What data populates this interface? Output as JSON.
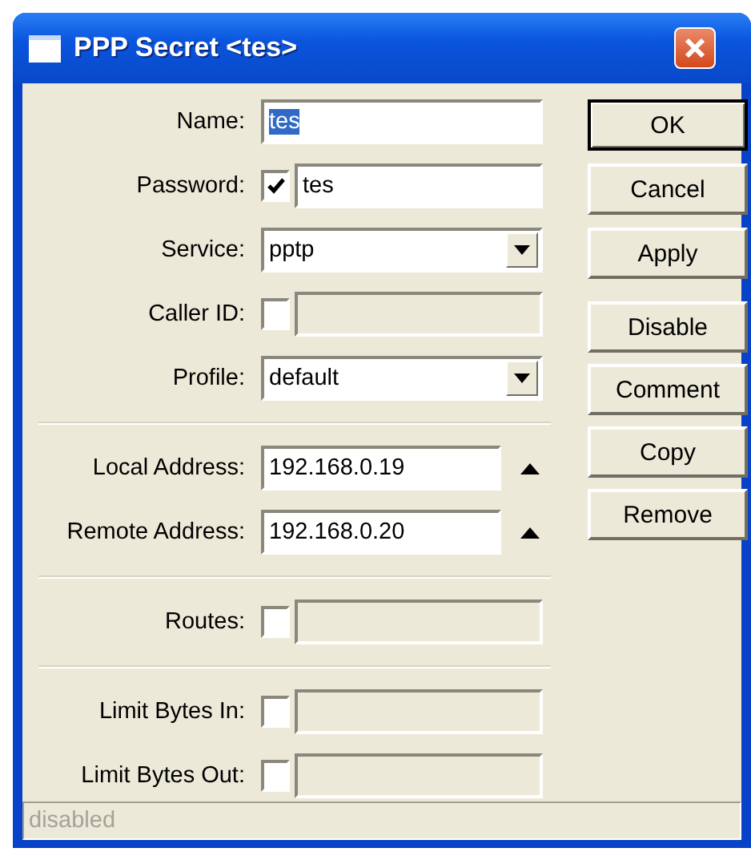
{
  "window": {
    "title": "PPP Secret <tes>"
  },
  "groups": [
    {
      "fields": [
        {
          "kind": "text",
          "label": "Name:",
          "value": "tes",
          "highlighted": true
        },
        {
          "kind": "checktext",
          "label": "Password:",
          "checked": true,
          "value": "tes",
          "highlighted": false
        },
        {
          "kind": "combo",
          "label": "Service:",
          "value": "pptp"
        },
        {
          "kind": "checktext",
          "label": "Caller ID:",
          "checked": false
        },
        {
          "kind": "combo",
          "label": "Profile:",
          "value": "default"
        }
      ]
    },
    {
      "fields": [
        {
          "kind": "ip",
          "label": "Local Address:",
          "value": "192.168.0.19",
          "highlighted": false
        },
        {
          "kind": "ip",
          "label": "Remote Address:",
          "value": "192.168.0.20",
          "highlighted": false
        }
      ]
    },
    {
      "fields": [
        {
          "kind": "checktext",
          "label": "Routes:",
          "checked": false
        }
      ]
    },
    {
      "fields": [
        {
          "kind": "checktext",
          "label": "Limit Bytes In:",
          "checked": false
        },
        {
          "kind": "checktext",
          "label": "Limit Bytes Out:",
          "checked": false
        }
      ]
    }
  ],
  "buttons": [
    [
      {
        "label": "OK",
        "default": true
      },
      {
        "label": "Cancel",
        "default": false
      },
      {
        "label": "Apply",
        "default": false
      }
    ],
    [
      {
        "label": "Disable",
        "default": false
      },
      {
        "label": "Comment",
        "default": false
      },
      {
        "label": "Copy",
        "default": false
      },
      {
        "label": "Remove",
        "default": false
      }
    ]
  ],
  "status_bar": "disabled"
}
